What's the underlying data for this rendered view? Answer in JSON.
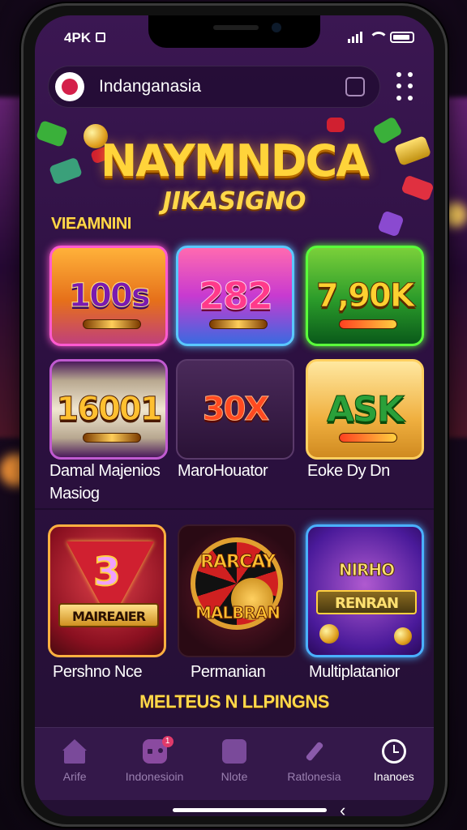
{
  "status": {
    "time": "4PK"
  },
  "browser": {
    "site_name": "Indanganasia"
  },
  "hero": {
    "title": "NAYMNDCA",
    "subtitle": "JIKASIGNO"
  },
  "section_label": "VIEAMNINI",
  "tiles_row1": [
    {
      "value": "100s",
      "icon": "slot-bar"
    },
    {
      "value": "282",
      "icon": "slot-bar"
    },
    {
      "value": "7,90K",
      "icon": "pepper-icon"
    }
  ],
  "tiles_row2": [
    {
      "value": "16001",
      "icon": "slot-bar"
    },
    {
      "value": "30X"
    },
    {
      "value": "ASK",
      "icon": "pepper-icon"
    }
  ],
  "labels_row2": [
    {
      "line1": "Damal Majenios",
      "line2": "Masiog"
    },
    {
      "line1": "MaroHouator"
    },
    {
      "line1": "Eoke Dy Dn"
    }
  ],
  "games": [
    {
      "emblem_text": "3",
      "banner": "MAIREAIER",
      "label": "Pershno Nce"
    },
    {
      "banner_top": "RARCAY",
      "banner_bottom": "MALBRAN",
      "label": "Permanian"
    },
    {
      "banner_top": "NIRHO",
      "banner_bottom": "RENRAN",
      "label": "Multiplatanior"
    }
  ],
  "footer_text": "MELTEUS N LLPINGNS",
  "tabbar": [
    {
      "label": "Arife",
      "icon": "home-icon"
    },
    {
      "label": "Indonesioin",
      "icon": "gamepad-icon",
      "badge": "1"
    },
    {
      "label": "Nlote",
      "icon": "bag-icon"
    },
    {
      "label": "Ratlonesia",
      "icon": "tools-icon"
    },
    {
      "label": "Inanoes",
      "icon": "clock-icon",
      "active": true
    }
  ],
  "colors": {
    "accent": "#ffd84a",
    "background": "#2c1040",
    "tabbar": "#34184a"
  }
}
